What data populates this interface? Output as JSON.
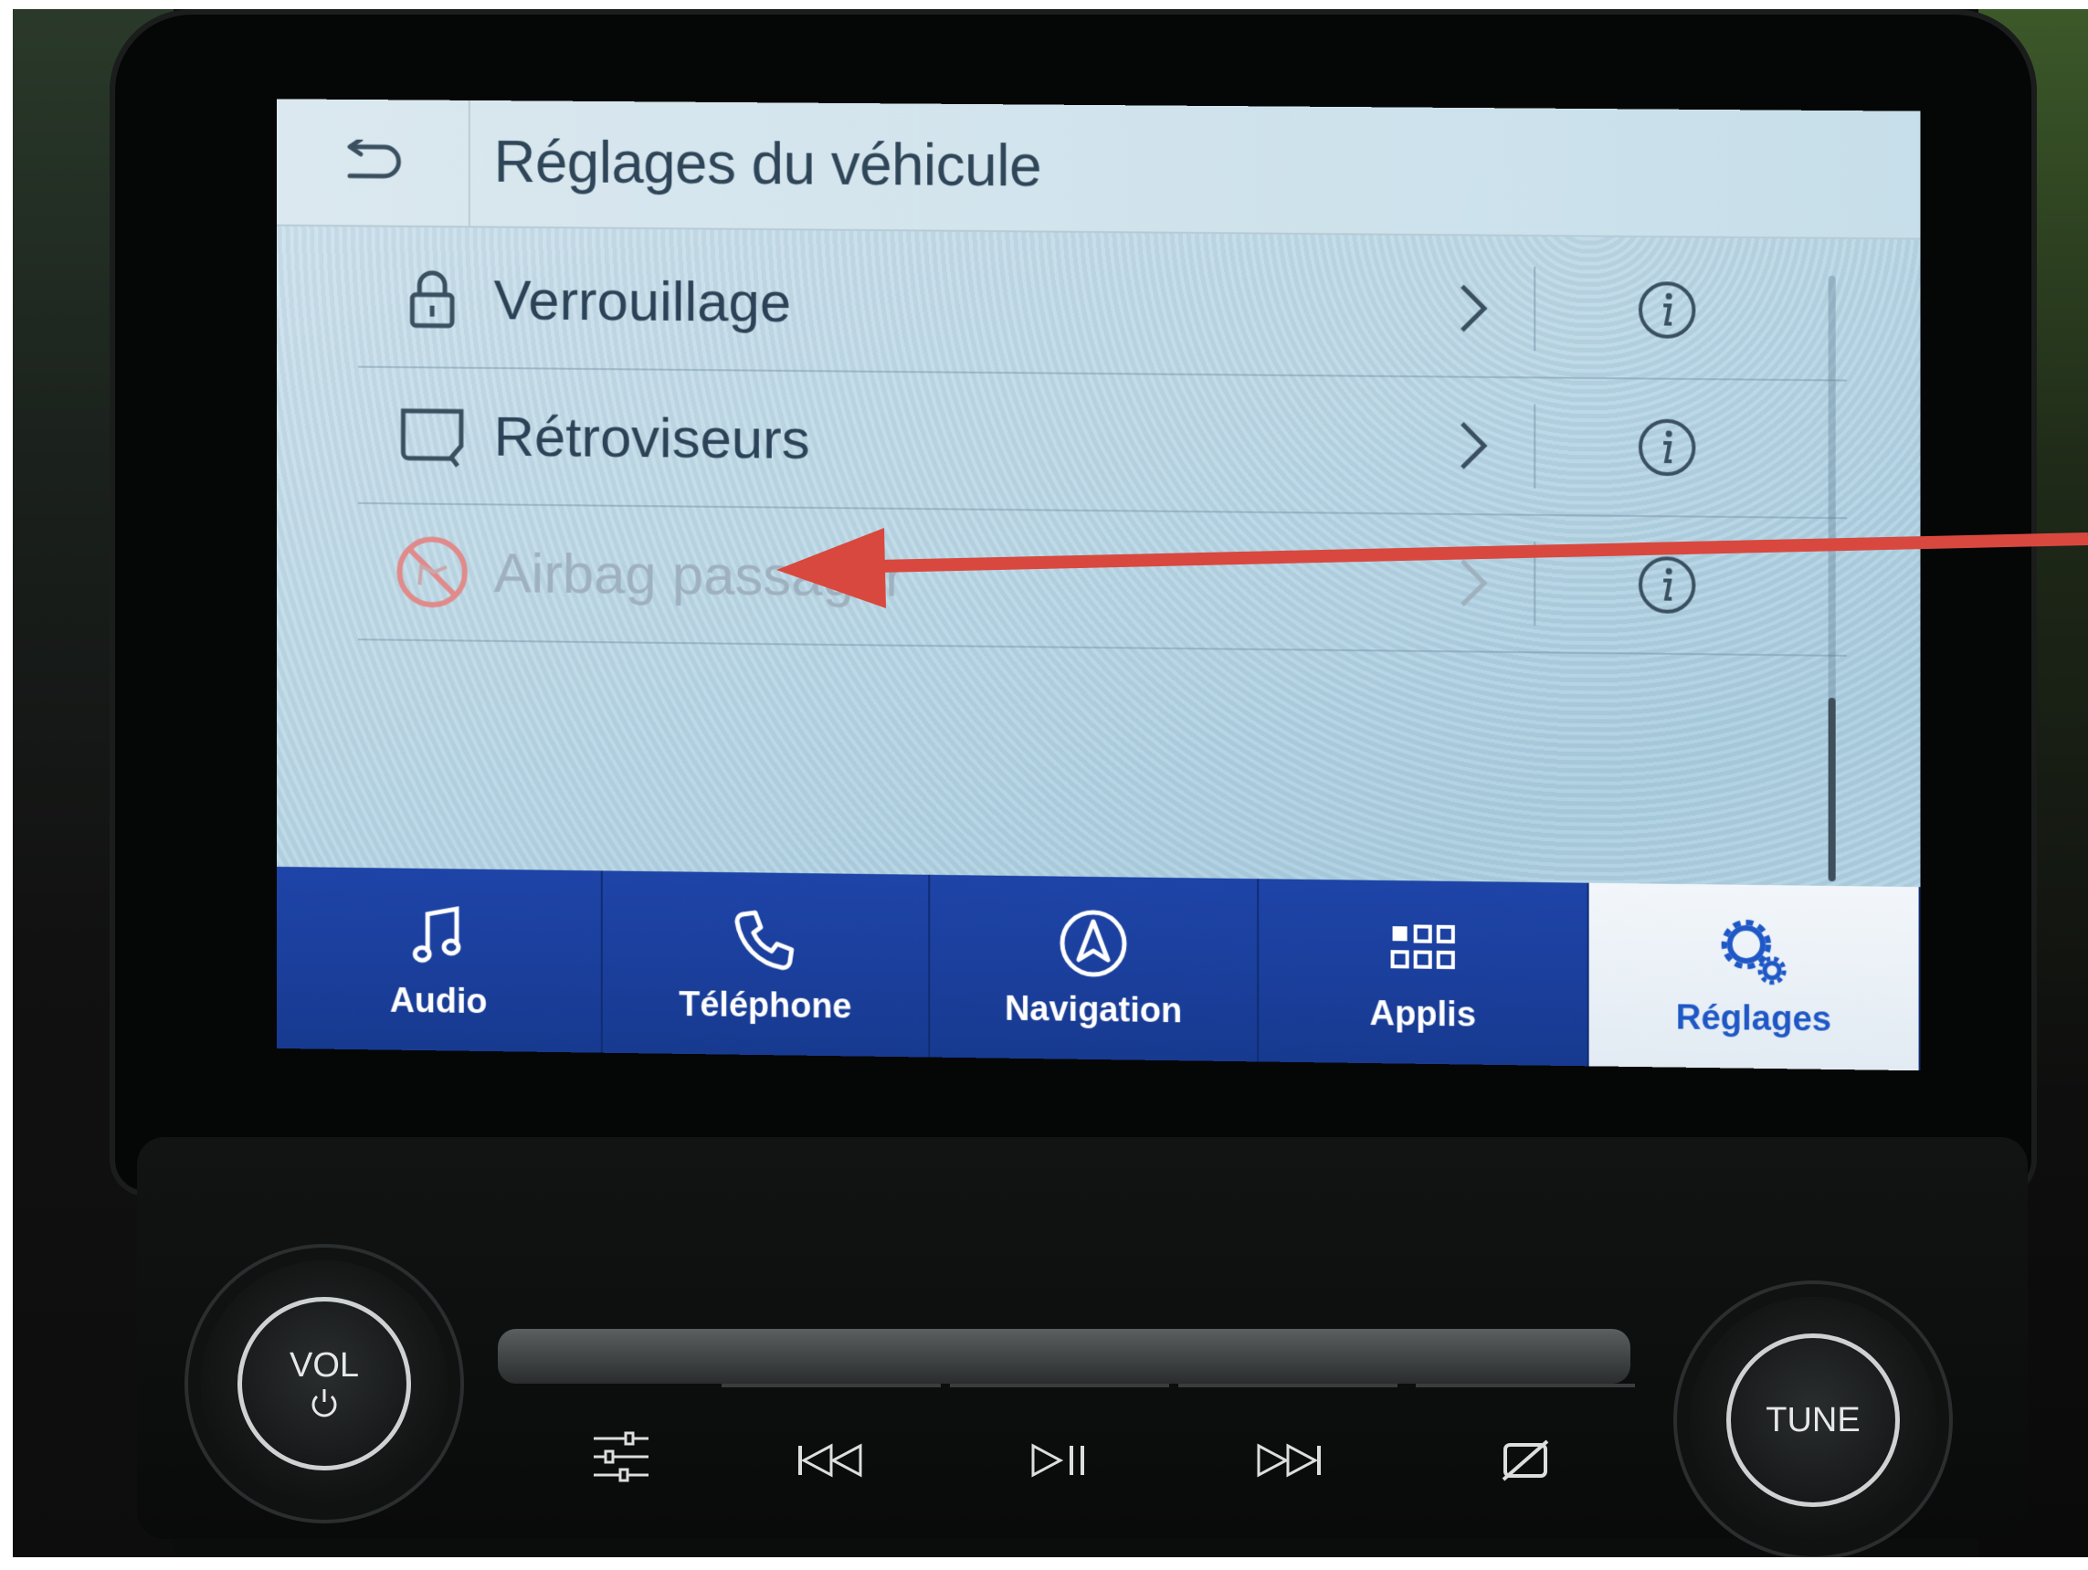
{
  "screen": {
    "title": "Réglages du véhicule",
    "rows": [
      {
        "label": "Verrouillage",
        "icon": "lock-icon",
        "enabled": true
      },
      {
        "label": "Rétroviseurs",
        "icon": "mirror-icon",
        "enabled": true
      },
      {
        "label": "Airbag passager",
        "icon": "airbag-off-icon",
        "enabled": false
      }
    ]
  },
  "navbar": {
    "items": [
      {
        "label": "Audio",
        "icon": "music-note-icon"
      },
      {
        "label": "Téléphone",
        "icon": "phone-icon"
      },
      {
        "label": "Navigation",
        "icon": "navigation-arrow-icon"
      },
      {
        "label": "Applis",
        "icon": "apps-grid-icon"
      },
      {
        "label": "Réglages",
        "icon": "gears-icon",
        "active": true
      }
    ]
  },
  "hardware": {
    "vol_label": "VOL",
    "tune_label": "TUNE"
  },
  "colors": {
    "nav_blue": "#1e44a8",
    "active_text": "#1f58c6",
    "annotation_arrow": "#d9483f"
  }
}
